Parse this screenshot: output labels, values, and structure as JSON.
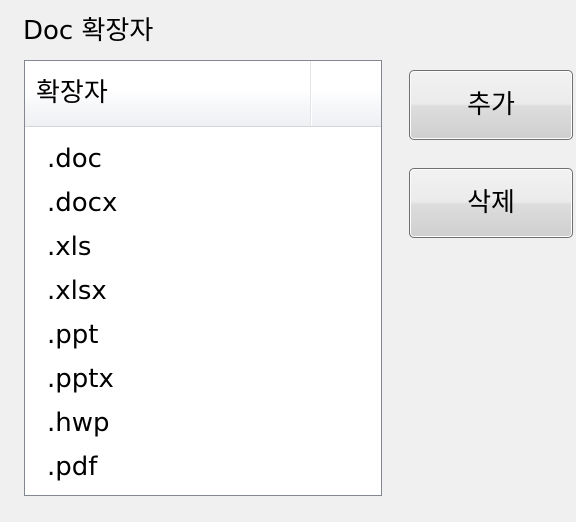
{
  "group": {
    "title": "Doc 확장자"
  },
  "list": {
    "column_header": "확장자",
    "items": [
      ".doc",
      ".docx",
      ".xls",
      ".xlsx",
      ".ppt",
      ".pptx",
      ".hwp",
      ".pdf"
    ]
  },
  "buttons": {
    "add_label": "추가",
    "delete_label": "삭제"
  }
}
